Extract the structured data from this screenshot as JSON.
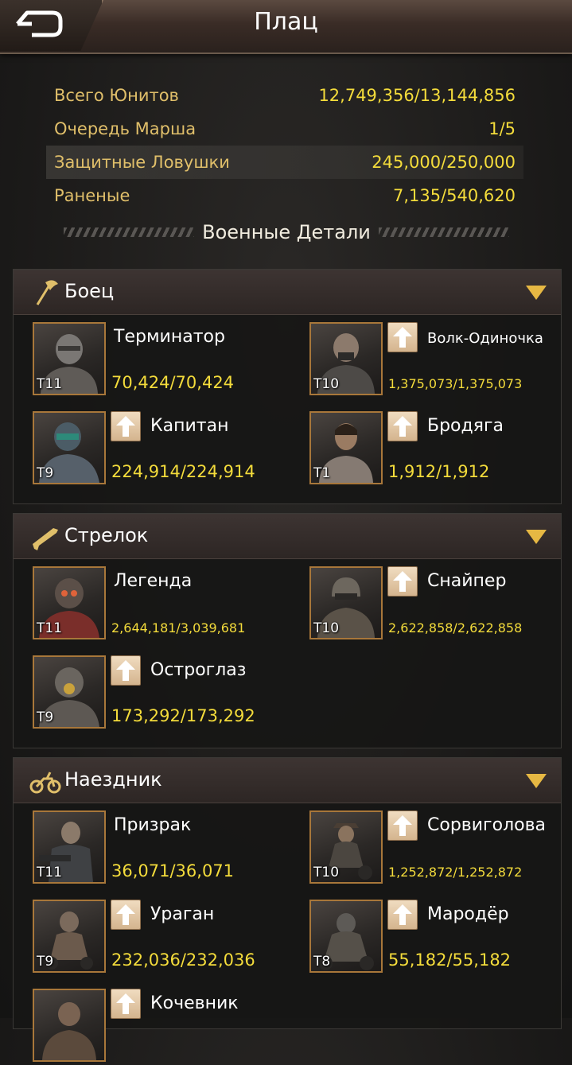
{
  "header": {
    "title": "Плац"
  },
  "stats": [
    {
      "label": "Всего Юнитов",
      "value": "12,749,356/13,144,856"
    },
    {
      "label": "Очередь Марша",
      "value": "1/5"
    },
    {
      "label": "Защитные Ловушки",
      "value": "245,000/250,000"
    },
    {
      "label": "Раненые",
      "value": "7,135/540,620"
    }
  ],
  "details_title": "Военные Детали",
  "sections": [
    {
      "title": "Боец",
      "icon": "axe-icon",
      "units": [
        {
          "name": "Терминатор",
          "count": "70,424/70,424",
          "tier": "T11",
          "upgrade": false
        },
        {
          "name": "Волк-Одиночка",
          "count": "1,375,073/1,375,073",
          "tier": "T10",
          "upgrade": true
        },
        {
          "name": "Капитан",
          "count": "224,914/224,914",
          "tier": "T9",
          "upgrade": true
        },
        {
          "name": "Бродяга",
          "count": "1,912/1,912",
          "tier": "T1",
          "upgrade": true
        }
      ]
    },
    {
      "title": "Стрелок",
      "icon": "rifle-icon",
      "units": [
        {
          "name": "Легенда",
          "count": "2,644,181/3,039,681",
          "tier": "T11",
          "upgrade": false
        },
        {
          "name": "Снайпер",
          "count": "2,622,858/2,622,858",
          "tier": "T10",
          "upgrade": true
        },
        {
          "name": "Остроглаз",
          "count": "173,292/173,292",
          "tier": "T9",
          "upgrade": true
        }
      ]
    },
    {
      "title": "Наездник",
      "icon": "motorcycle-icon",
      "units": [
        {
          "name": "Призрак",
          "count": "36,071/36,071",
          "tier": "T11",
          "upgrade": false
        },
        {
          "name": "Сорвиголова",
          "count": "1,252,872/1,252,872",
          "tier": "T10",
          "upgrade": true
        },
        {
          "name": "Ураган",
          "count": "232,036/232,036",
          "tier": "T9",
          "upgrade": true
        },
        {
          "name": "Мародёр",
          "count": "55,182/55,182",
          "tier": "T8",
          "upgrade": true
        },
        {
          "name": "Кочевник",
          "count": "",
          "tier": "",
          "upgrade": true
        }
      ]
    }
  ],
  "colors": {
    "label": "#e0bf6a",
    "value": "#f4dc3b",
    "accent": "#a8773a"
  }
}
